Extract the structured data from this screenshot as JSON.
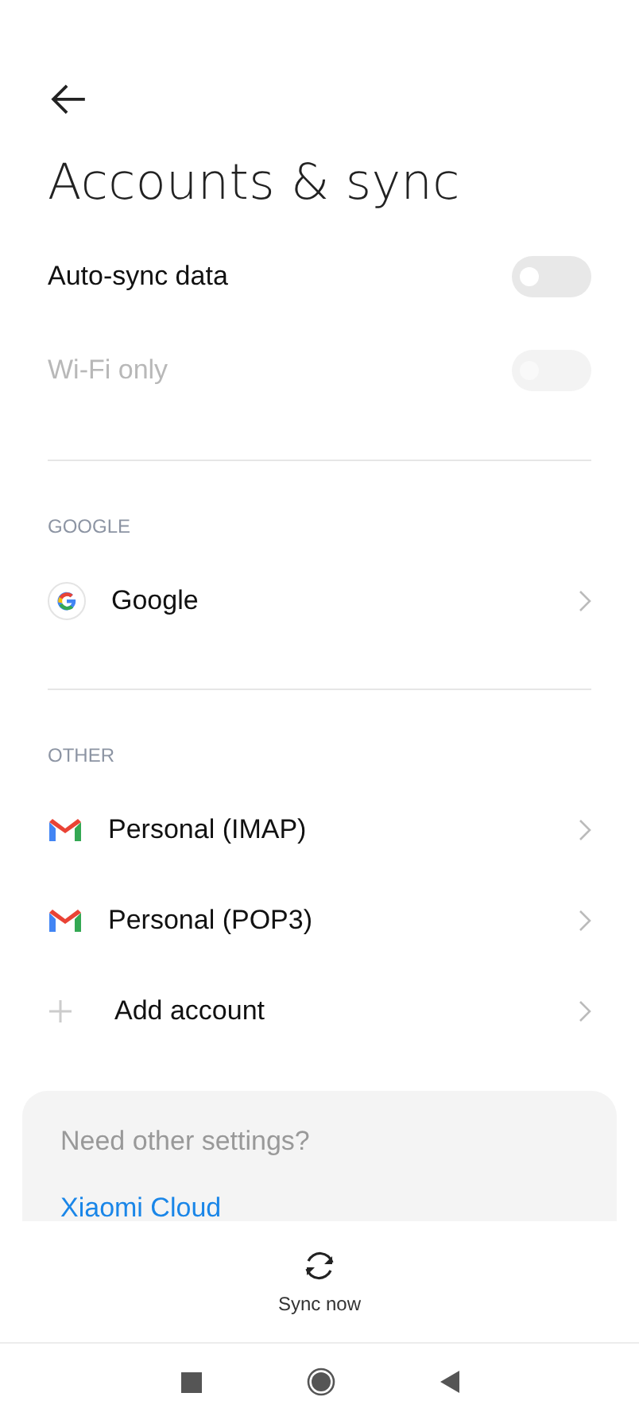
{
  "title": "Accounts & sync",
  "toggles": [
    {
      "label": "Auto-sync data",
      "on": false,
      "disabled": false
    },
    {
      "label": "Wi-Fi only",
      "on": false,
      "disabled": true
    }
  ],
  "sections": [
    {
      "header": "GOOGLE",
      "items": [
        {
          "kind": "google",
          "label": "Google"
        }
      ]
    },
    {
      "header": "OTHER",
      "items": [
        {
          "kind": "gmail",
          "label": "Personal (IMAP)"
        },
        {
          "kind": "gmail",
          "label": "Personal (POP3)"
        },
        {
          "kind": "add",
          "label": "Add account"
        }
      ]
    }
  ],
  "card": {
    "question": "Need other settings?",
    "link": "Xiaomi Cloud"
  },
  "action": {
    "label": "Sync now"
  }
}
